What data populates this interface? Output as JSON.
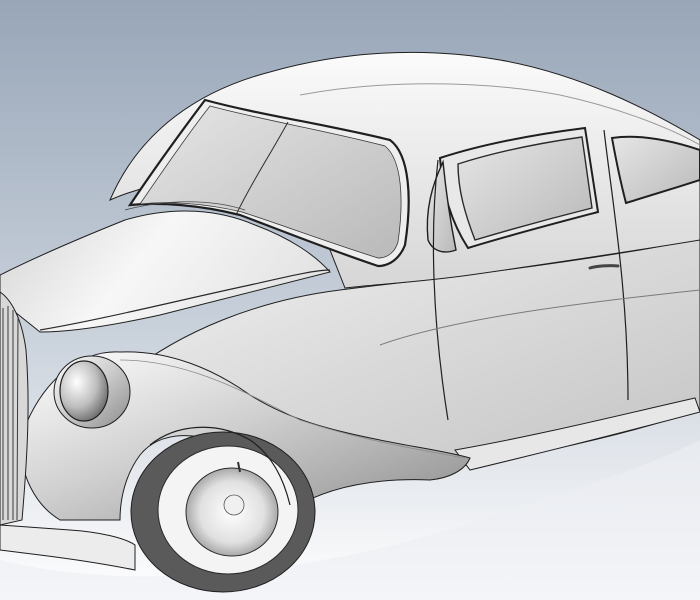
{
  "viewport": {
    "background_top": "#98a6b8",
    "background_bottom": "#ffffff"
  },
  "model": {
    "body_light": "#f6f6f6",
    "body_mid": "#cfcfcf",
    "body_dark": "#8f8f8f",
    "glass": "#bdbdbd",
    "edge_color": "#1f1f1f",
    "tire": "#5a5a5a"
  }
}
